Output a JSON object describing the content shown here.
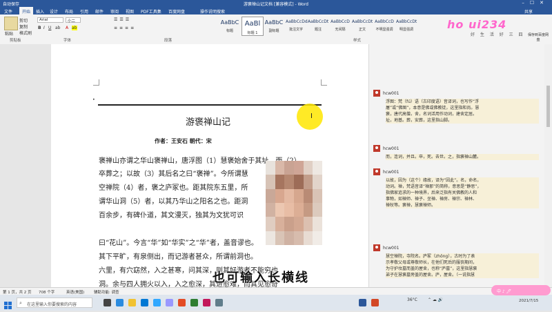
{
  "window": {
    "title": "游褒禅山记文档 [兼容模式] - Word",
    "quick_access": "自动保存"
  },
  "ribbon_tabs": [
    "文件",
    "开始",
    "插入",
    "设计",
    "布局",
    "引用",
    "邮件",
    "审阅",
    "视图",
    "PDF工具集",
    "百度网盘",
    "操作说明搜索"
  ],
  "active_tab": "开始",
  "ribbon": {
    "share_label": "共享",
    "paste_label": "粘贴",
    "cut_label": "剪切",
    "copy_label": "复制",
    "format_painter_label": "格式刷",
    "font_name": "Arial",
    "font_size": "小二",
    "group_clipboard": "剪贴板",
    "group_font": "字体",
    "group_paragraph": "段落",
    "group_styles": "样式",
    "styles": [
      {
        "sample": "AaBbC",
        "name": "标题"
      },
      {
        "sample": "AaBl",
        "name": "标题 1"
      },
      {
        "sample": "AaBbC",
        "name": "副标题"
      },
      {
        "sample": "AaBbCcDd",
        "name": "批注文字"
      },
      {
        "sample": "AaBbCcDt",
        "name": "题注"
      },
      {
        "sample": "AaBbCcD",
        "name": "无间隔"
      },
      {
        "sample": "AaBbCcDt",
        "name": "正文"
      },
      {
        "sample": "AaBbCcD",
        "name": "不明显强调"
      },
      {
        "sample": "AaBbCcDt",
        "name": "明显强调"
      }
    ],
    "save_label": "保存到百度网盘"
  },
  "watermark_logo": {
    "text": "ho ui234",
    "tagline": "好 生 活 好 三 四"
  },
  "document": {
    "title": "游褒禅山记",
    "author_line": "作者：王安石   朝代：宋",
    "paragraphs": [
      "褒禅山亦谓之华山褒禅山，唐浮图（1）慧褒始舍于其址，而（2）",
      "卒葬之；以故（3）其后名之曰“褒禅”。今所谓慧",
      "空禅院（4）者，褒之庐冢也。距其院东五里，所",
      "谓华山洞（5）者，以其乃华山之阳名之也。距洞",
      "百余步，有碑仆道，其文漫灭，独其为文犹可识",
      "",
      "曰“花山”。今言“华”如“华实”之“华”者，盖音谬也。",
      "",
      "其下平旷，有泉侧出，而记游者甚众，所谓前洞也。",
      "六里，有穴窈然，入之甚寒，问其深，则其好游者不能穷也",
      "洞。余与四人拥火以入，入之愈深，其进愈难，而其见愈奇"
    ]
  },
  "comments": [
    {
      "author": "hcw001",
      "text": [
        "浮图：梵（fú）语（古印度语）音译词，也写作“浮",
        "屠”或“佛图”，本意是佛或佛教徒，这里指和尚。慧",
        "褒，唐代高僧。舍，名词活用作动词，建舍定居。",
        "址，地基。葬，安葬，这里指山脚。"
      ]
    },
    {
      "author": "hcw001",
      "text": [
        "而，连词，并且。卒，死。去世。之，指褒禅山麓。"
      ]
    },
    {
      "author": "hcw001",
      "text": [
        "以故，因为（这个）缘故，译为“因此”。名，命名，",
        "动词。禅，梵语音译“禅那”的简称，意思是“静思”，",
        "指佛家追求的一种境界，后来泛指有关佛教的人和",
        "事物，如禅师、禅子、坐禅、禅房、禅宗、禅林、",
        "禅杖等。褒禅，慧褒禅师。"
      ]
    },
    {
      "author": "hcw001",
      "text": [
        "慧空禅院，寺院名。庐冢（zhǒng），古时为了表",
        "示孝敬父母或尊敬师长，在他们死后的服丧期间，",
        "为守护坟墓而盖的屋舍，也称“庐墓”，这里指慧褒",
        "弟子在慧褒墓旁盖的屋舍。庐，屋舍。（一说指慧",
        "褒生前的屋舍）。冢，坟墓。"
      ]
    }
  ],
  "subtitle_caption": "也可输入长横线",
  "statusbar": {
    "page": "第 1 页，共 2 页",
    "words": "708 个字",
    "language": "英语(美国)",
    "accessibility": "辅助功能: 调查"
  },
  "taskbar": {
    "search_placeholder": "在这里输入你要搜索的内容",
    "weather": "36°C",
    "time": "2021/7/15"
  },
  "sticker_text": "中 ♪ 🖊"
}
